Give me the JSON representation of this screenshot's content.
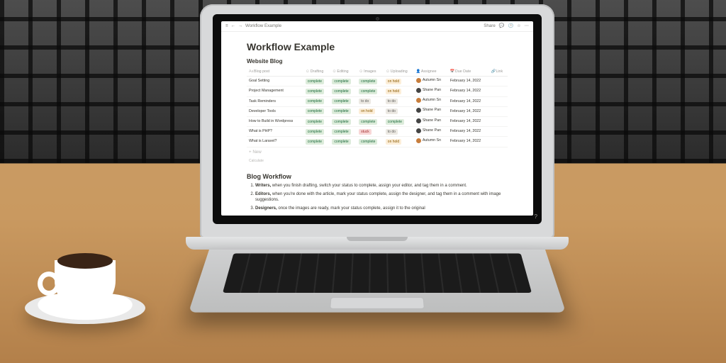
{
  "topbar": {
    "breadcrumb": "Workflow Example",
    "share_label": "Share"
  },
  "page": {
    "title": "Workflow Example",
    "db_title": "Website Blog",
    "columns": {
      "name": "Blog post",
      "drafting": "Drafting",
      "editing": "Editing",
      "images": "Images",
      "uploading": "Uploading",
      "assignee": "Assignee",
      "due": "Due Date",
      "link": "Link"
    },
    "rows": [
      {
        "name": "Goal Setting",
        "drafting": "complete",
        "editing": "complete",
        "images": "complete",
        "uploading": "on hold",
        "assignee": "Autumn Sn",
        "due": "February 14, 2022",
        "avatar": "#c77d3c"
      },
      {
        "name": "Project Management",
        "drafting": "complete",
        "editing": "complete",
        "images": "complete",
        "uploading": "on hold",
        "assignee": "Shane Pan",
        "due": "February 14, 2022",
        "avatar": "#444"
      },
      {
        "name": "Task Reminders",
        "drafting": "complete",
        "editing": "complete",
        "images": "to do",
        "uploading": "to do",
        "assignee": "Autumn Sn",
        "due": "February 14, 2022",
        "avatar": "#c77d3c"
      },
      {
        "name": "Developer Tools",
        "drafting": "complete",
        "editing": "complete",
        "images": "on hold",
        "uploading": "to do",
        "assignee": "Shane Pan",
        "due": "February 14, 2022",
        "avatar": "#444"
      },
      {
        "name": "How to Build in Wordpress",
        "drafting": "complete",
        "editing": "complete",
        "images": "complete",
        "uploading": "complete",
        "assignee": "Shane Pan",
        "due": "February 14, 2022",
        "avatar": "#444"
      },
      {
        "name": "What is PHP?",
        "drafting": "complete",
        "editing": "complete",
        "images": "stuck",
        "uploading": "to do",
        "assignee": "Shane Pan",
        "due": "February 14, 2022",
        "avatar": "#444"
      },
      {
        "name": "What is Laravel?",
        "drafting": "complete",
        "editing": "complete",
        "images": "complete",
        "uploading": "on hold",
        "assignee": "Autumn Sn",
        "due": "February 14, 2022",
        "avatar": "#c77d3c"
      }
    ],
    "new_row": "+  New",
    "calculate": "Calculate",
    "workflow_title": "Blog Workflow",
    "steps": [
      "Writers, when you finish drafting, switch your status to complete, assign your editor, and tag them in a comment.",
      "Editors, when you're done with the article, mark your status complete, assign the designer, and tag them in a comment with image suggestions.",
      "Designers, once the images are ready, mark your status complete, assign it to the original"
    ]
  },
  "help": "?"
}
